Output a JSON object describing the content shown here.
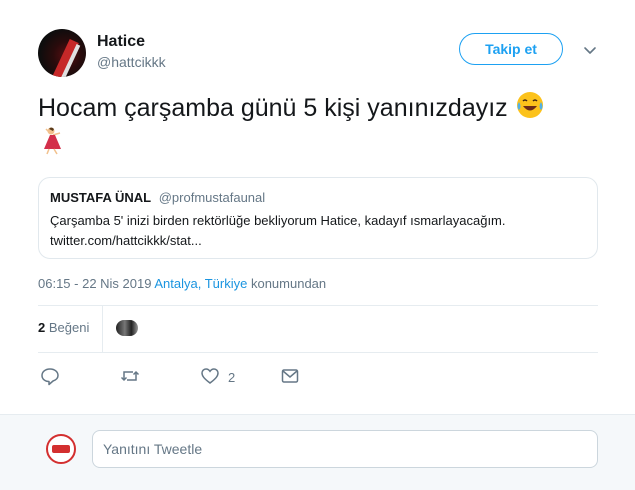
{
  "author": {
    "name": "Hatice",
    "handle": "@hattcikkk"
  },
  "follow_label": "Takip et",
  "tweet": {
    "text": "Hocam çarşamba günü 5 kişi yanınızdayız",
    "emojis": [
      "tears-of-joy-icon",
      "dancer-icon"
    ]
  },
  "quote": {
    "name": "MUSTAFA ÜNAL",
    "handle": "@profmustafaunal",
    "text": "Çarşamba 5' inizi birden rektörlüğe bekliyorum Hatice, kadayıf ısmarlayacağım.",
    "link": "twitter.com/hattcikkk/stat..."
  },
  "meta": {
    "time": "06:15 - 22 Nis 2019",
    "location": "Antalya, Türkiye",
    "suffix": "konumundan"
  },
  "stats": {
    "likes_count": "2",
    "likes_label": "Beğeni"
  },
  "actions": {
    "like_count": "2"
  },
  "reply": {
    "placeholder": "Yanıtını Tweetle"
  },
  "colors": {
    "accent": "#1da1f2",
    "muted": "#657786"
  }
}
